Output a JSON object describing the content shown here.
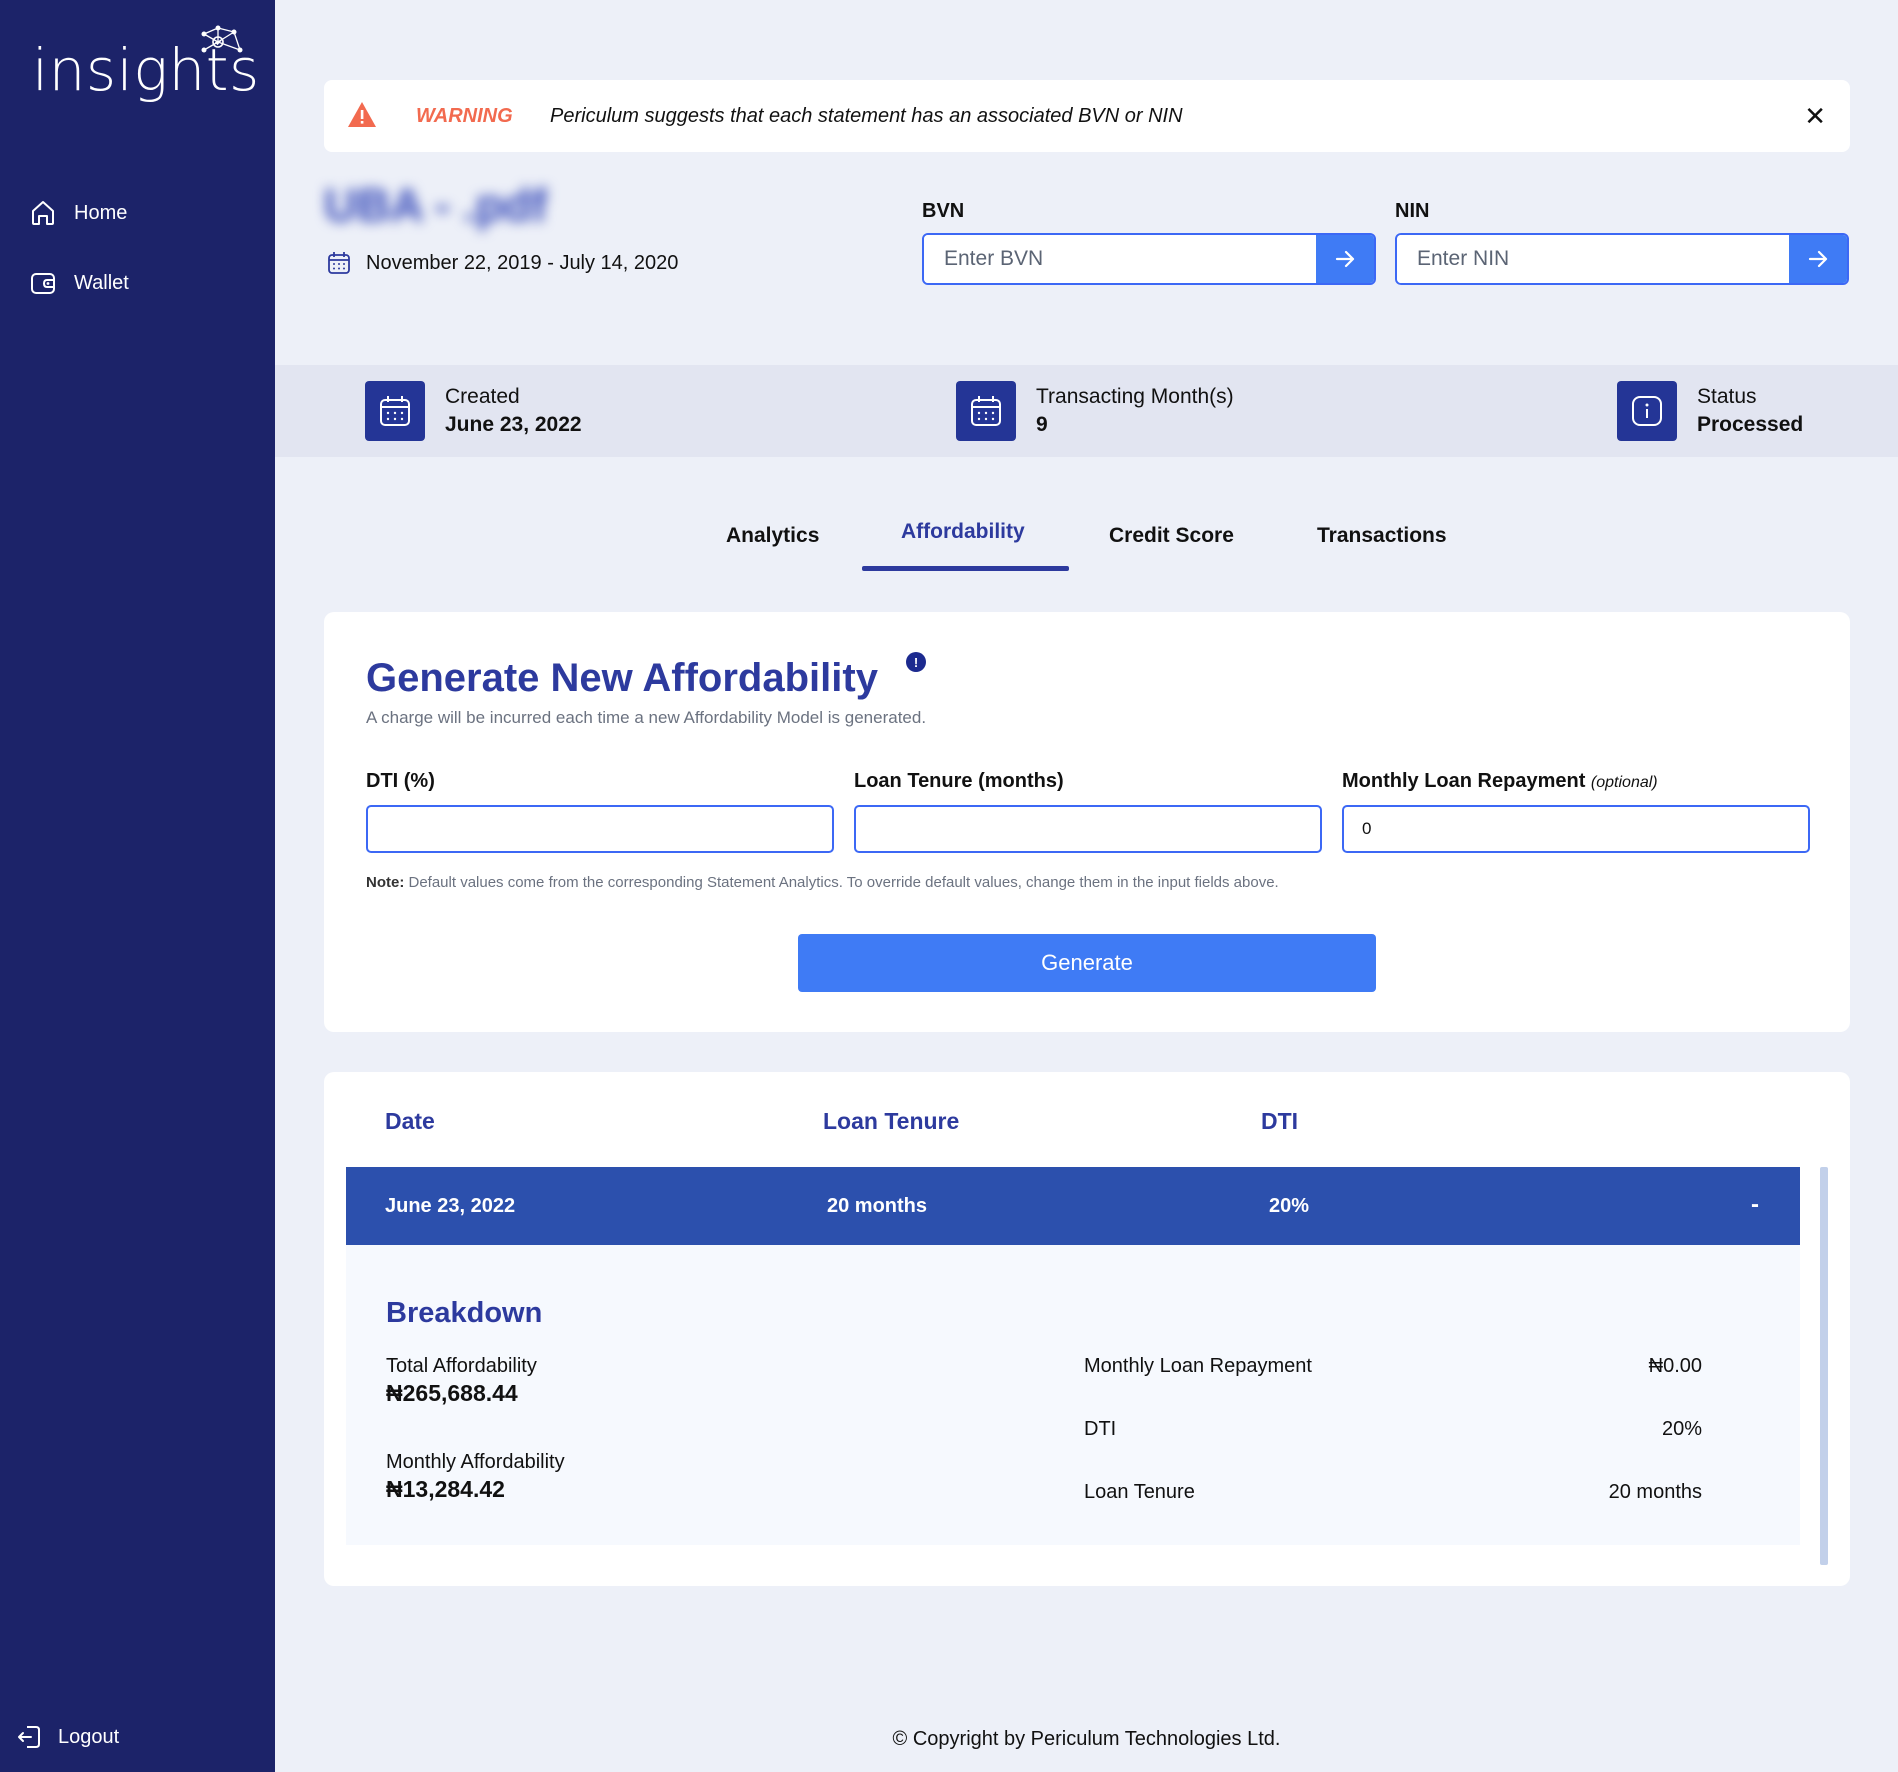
{
  "app": {
    "logo_text": "insights"
  },
  "sidebar": {
    "items": [
      {
        "label": "Home",
        "icon": "home-icon"
      },
      {
        "label": "Wallet",
        "icon": "wallet-icon"
      }
    ],
    "logout_label": "Logout"
  },
  "warning": {
    "label": "WARNING",
    "message": "Periculum suggests that each statement has an associated BVN or NIN",
    "close_icon": "close-icon"
  },
  "statement": {
    "file_name": "UBA - .pdf",
    "date_range": "November 22, 2019 - July 14, 2020"
  },
  "bvn": {
    "label": "BVN",
    "placeholder": "Enter BVN"
  },
  "nin": {
    "label": "NIN",
    "placeholder": "Enter NIN"
  },
  "info": {
    "created_label": "Created",
    "created_value": "June 23, 2022",
    "months_label": "Transacting Month(s)",
    "months_value": "9",
    "status_label": "Status",
    "status_value": "Processed"
  },
  "tabs": [
    "Analytics",
    "Affordability",
    "Credit Score",
    "Transactions"
  ],
  "active_tab": "Affordability",
  "generate": {
    "title": "Generate New Affordability",
    "subtitle": "A charge will be incurred each time a new Affordability Model is generated.",
    "dti_label": "DTI (%)",
    "dti_value": "",
    "tenure_label": "Loan Tenure (months)",
    "tenure_value": "",
    "repayment_label": "Monthly Loan Repayment",
    "repayment_optional": "(optional)",
    "repayment_value": "0",
    "note_bold": "Note:",
    "note_text": " Default values come from the corresponding Statement Analytics. To override default values, change them in the input fields above.",
    "button_label": "Generate"
  },
  "history": {
    "headers": {
      "date": "Date",
      "tenure": "Loan Tenure",
      "dti": "DTI"
    },
    "row": {
      "date": "June 23, 2022",
      "tenure": "20 months",
      "dti": "20%",
      "toggle": "-"
    },
    "breakdown": {
      "title": "Breakdown",
      "total_label": "Total Affordability",
      "total_value": "₦265,688.44",
      "monthly_label": "Monthly Affordability",
      "monthly_value": "₦13,284.42",
      "repayment_label": "Monthly Loan Repayment",
      "repayment_value": "₦0.00",
      "dti_label": "DTI",
      "dti_value": "20%",
      "tenure_label": "Loan Tenure",
      "tenure_value": "20 months"
    }
  },
  "footer": {
    "copyright": "© Copyright by Periculum Technologies Ltd."
  },
  "colors": {
    "sidebar": "#1c2369",
    "accent": "#3f7bf5",
    "primary": "#2d3a9e",
    "warning": "#f26a4f"
  }
}
